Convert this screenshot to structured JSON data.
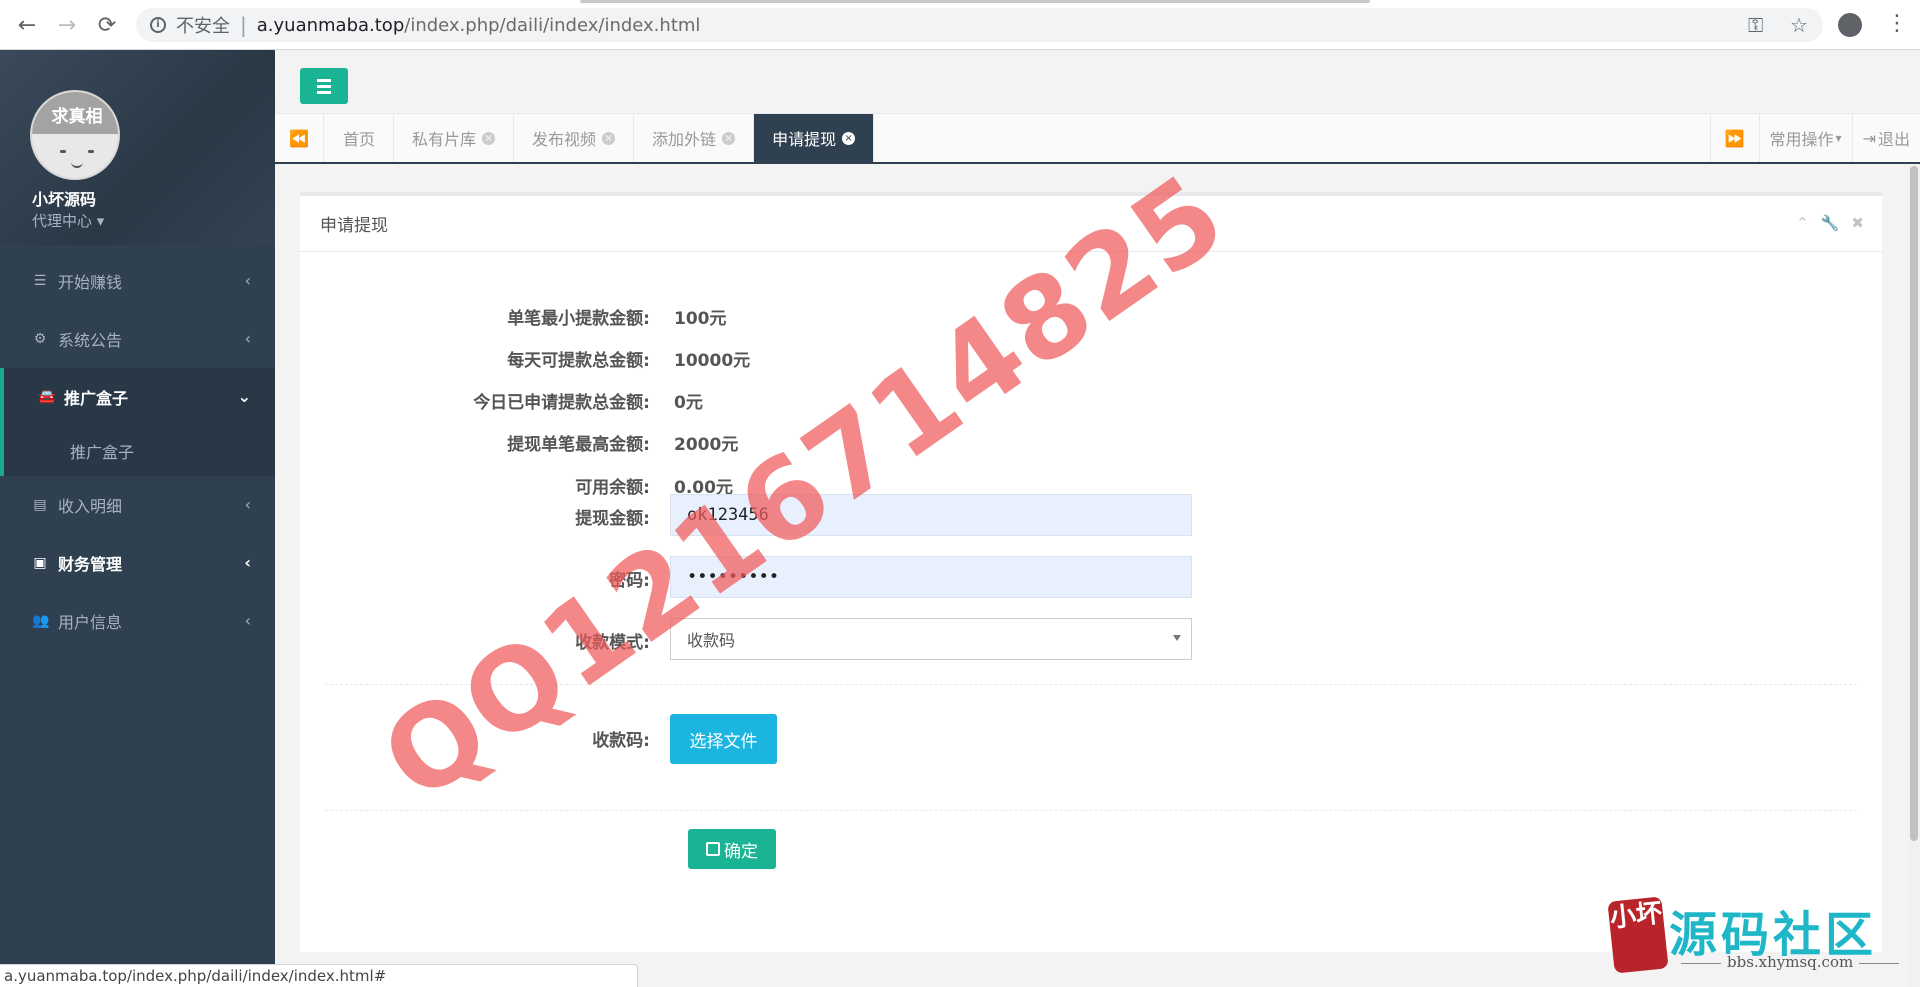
{
  "browser": {
    "back_icon": "←",
    "forward_icon": "→",
    "reload_icon": "⟳",
    "security_label": "不安全",
    "url_host": "a.yuanmaba.top",
    "url_path": "/index.php/daili/index/index.html",
    "status_url": "a.yuanmaba.top/index.php/daili/index/index.html#"
  },
  "sidebar": {
    "avatar_text": "求真相",
    "user_name": "小坏源码",
    "user_role": "代理中心",
    "items": [
      {
        "label": "开始赚钱",
        "icon": "database-icon"
      },
      {
        "label": "系统公告",
        "icon": "gear-icon"
      },
      {
        "label": "推广盒子",
        "icon": "car-icon"
      },
      {
        "label": "收入明细",
        "icon": "card-icon"
      },
      {
        "label": "财务管理",
        "icon": "files-icon"
      },
      {
        "label": "用户信息",
        "icon": "users-icon"
      }
    ],
    "submenu": {
      "label": "推广盒子"
    }
  },
  "tabs": [
    {
      "label": "首页"
    },
    {
      "label": "私有片库"
    },
    {
      "label": "发布视频"
    },
    {
      "label": "添加外链"
    },
    {
      "label": "申请提现"
    }
  ],
  "tab_tools": {
    "ops_label": "常用操作",
    "logout_label": "退出"
  },
  "panel": {
    "title": "申请提现"
  },
  "form": {
    "min_label": "单笔最小提款金额:",
    "min_value": "100元",
    "daily_label": "每天可提款总金额:",
    "daily_value": "10000元",
    "today_label": "今日已申请提款总金额:",
    "today_value": "0元",
    "max_label": "提现单笔最高金额:",
    "max_value": "2000元",
    "balance_label": "可用余额:",
    "balance_value": "0.00元",
    "amount_label": "提现金额:",
    "amount_value": "ok123456",
    "password_label": "密码:",
    "password_value": "•••••••••",
    "mode_label": "收款模式:",
    "mode_value": "收款码",
    "qrcode_label": "收款码:",
    "file_button": "选择文件",
    "submit_button": "确定"
  },
  "watermark": "QQ1216714825",
  "site_logo": {
    "seal_text": "小坏",
    "brand": "源码社区",
    "url": "bbs.xhymsq.com"
  },
  "colors": {
    "sidebar_bg": "#2f4050",
    "accent": "#1ab394",
    "file_button": "#1cb5e0"
  }
}
